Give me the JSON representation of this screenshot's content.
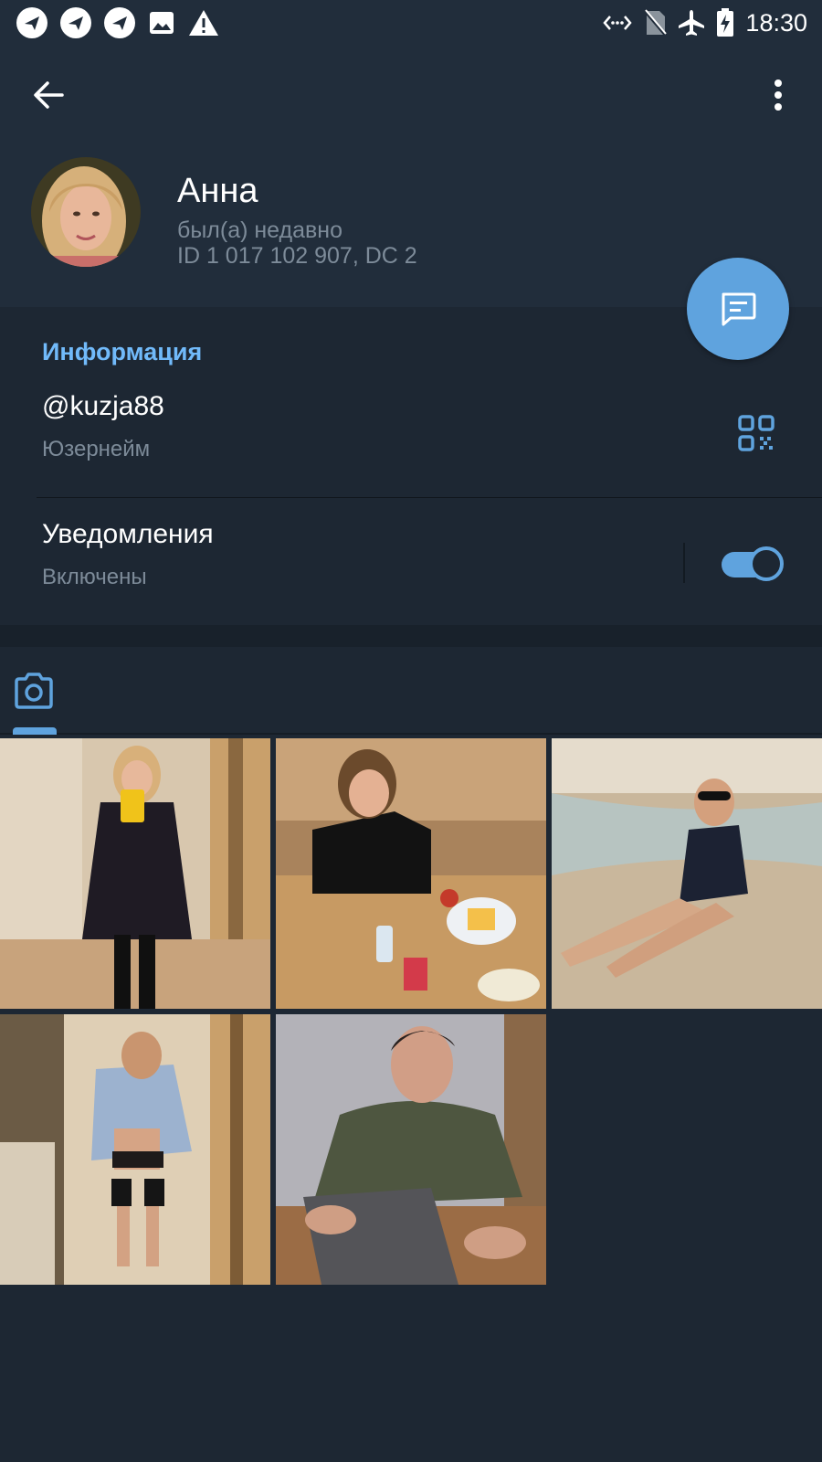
{
  "status_bar": {
    "time": "18:30",
    "icons": [
      "app-notification-icon",
      "app-notification-icon",
      "app-notification-icon",
      "image-icon",
      "warning-icon",
      "data-transfer-icon",
      "no-sim-icon",
      "airplane-mode-icon",
      "battery-charging-icon"
    ]
  },
  "profile": {
    "name": "Анна",
    "status": "был(а) недавно",
    "id_line": "ID 1 017 102 907, DC 2"
  },
  "info": {
    "section_title": "Информация",
    "username_value": "@kuzja88",
    "username_label": "Юзернейм",
    "notifications_title": "Уведомления",
    "notifications_state": "Включены",
    "notifications_enabled": true
  },
  "media": {
    "active_tab_icon": "camera-icon",
    "photos": [
      "photo-1",
      "photo-2",
      "photo-3",
      "photo-4",
      "photo-5"
    ]
  },
  "colors": {
    "accent": "#5fa3de",
    "section_title": "#71bafa",
    "background": "#1d2733",
    "header": "#212d3b",
    "secondary_text": "#7d8b99"
  }
}
